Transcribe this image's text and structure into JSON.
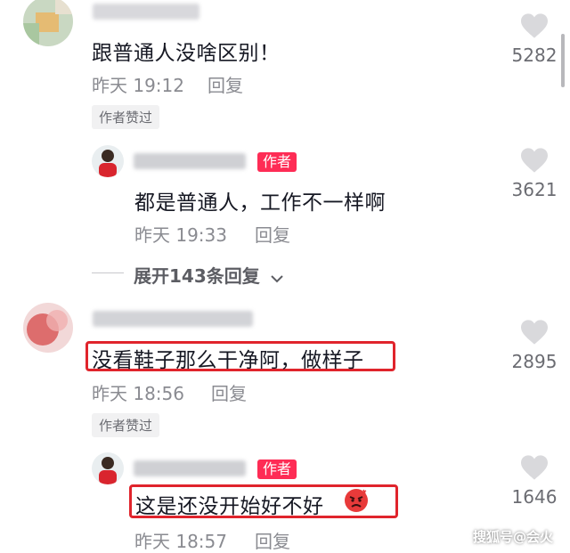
{
  "comments": [
    {
      "text": "跟普通人没啥区别！",
      "time": "昨天 19:12",
      "reply_label": "回复",
      "author_liked": "作者赞过",
      "likes": "5282"
    },
    {
      "text": "没看鞋子那么干净阿，做样子",
      "time": "昨天 18:56",
      "reply_label": "回复",
      "author_liked": "作者赞过",
      "likes": "2895"
    }
  ],
  "replies": [
    {
      "author_tag": "作者",
      "text": "都是普通人，工作不一样啊",
      "time": "昨天 19:33",
      "reply_label": "回复",
      "likes": "3621"
    },
    {
      "author_tag": "作者",
      "text": "这是还没开始好不好",
      "time": "昨天 18:57",
      "reply_label": "回复",
      "likes": "1646"
    }
  ],
  "expand_replies": "展开143条回复",
  "watermark": "搜狐号@会火",
  "colors": {
    "highlight_box": "#e0242c",
    "author_tag": "#fe2c55",
    "heart": "#d9d9dc"
  },
  "icons": {
    "heart": "heart-outline-icon",
    "chevron": "chevron-down-icon",
    "emoji": "angry-face-emoji-icon"
  }
}
